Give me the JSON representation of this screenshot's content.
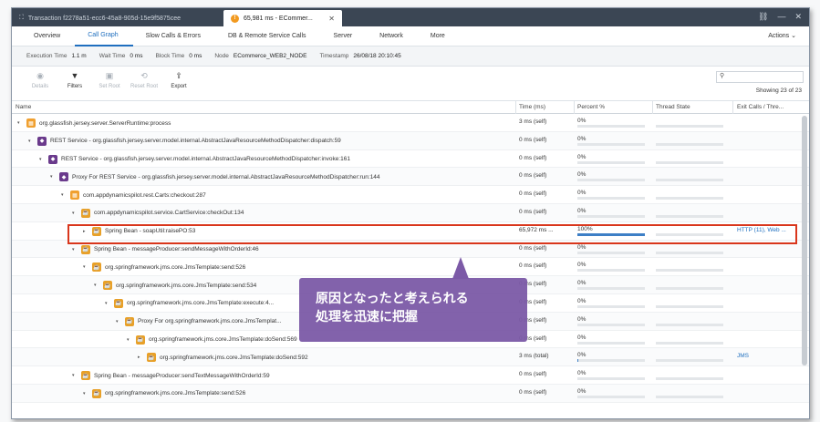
{
  "tabs": [
    {
      "label": "Transaction f2278a51-ecc6-45a8-905d-15e9f5875cee",
      "active": false
    },
    {
      "label": "65,981 ms - ECommer...",
      "active": true
    }
  ],
  "nav": [
    "Overview",
    "Call Graph",
    "Slow Calls & Errors",
    "DB & Remote Service Calls",
    "Server",
    "Network",
    "More"
  ],
  "actions_label": "Actions",
  "info": {
    "execution_time_label": "Execution Time",
    "execution_time": "1.1 m",
    "wait_time_label": "Wait Time",
    "wait_time": "0 ms",
    "block_time_label": "Block Time",
    "block_time": "0 ms",
    "node_label": "Node",
    "node": "ECommerce_WEB2_NODE",
    "timestamp_label": "Timestamp",
    "timestamp": "26/08/18 20:10:45"
  },
  "toolbar": {
    "details": "Details",
    "filters": "Filters",
    "set_root": "Set Root",
    "reset_root": "Reset Root",
    "export": "Export",
    "showing": "Showing 23 of 23"
  },
  "columns": {
    "name": "Name",
    "time": "Time (ms)",
    "percent": "Percent %",
    "thread": "Thread State",
    "exit": "Exit Calls / Thre..."
  },
  "rows": [
    {
      "depth": 0,
      "icon": "pkg",
      "label": "org.glassfish.jersey.server.ServerRuntime:process",
      "time": "3 ms (self)",
      "pct": "0%",
      "fill": 0
    },
    {
      "depth": 1,
      "icon": "rest",
      "label": "REST Service - org.glassfish.jersey.server.model.internal.AbstractJavaResourceMethodDispatcher:dispatch:59",
      "time": "0 ms (self)",
      "pct": "0%",
      "fill": 0
    },
    {
      "depth": 2,
      "icon": "rest",
      "label": "REST Service - org.glassfish.jersey.server.model.internal.AbstractJavaResourceMethodDispatcher:invoke:161",
      "time": "0 ms (self)",
      "pct": "0%",
      "fill": 0
    },
    {
      "depth": 3,
      "icon": "rest",
      "label": "Proxy For REST Service - org.glassfish.jersey.server.model.internal.AbstractJavaResourceMethodDispatcher:run:144",
      "time": "0 ms (self)",
      "pct": "0%",
      "fill": 0
    },
    {
      "depth": 4,
      "icon": "pkg",
      "label": "com.appdynamicspilot.rest.Carts:checkout:287",
      "time": "0 ms (self)",
      "pct": "0%",
      "fill": 0
    },
    {
      "depth": 5,
      "icon": "java",
      "label": "com.appdynamicspilot.service.CartService:checkOut:134",
      "time": "0 ms (self)",
      "pct": "0%",
      "fill": 0
    },
    {
      "depth": 6,
      "icon": "java",
      "label": "Spring Bean - soapUtil:raisePO:53",
      "time": "65,972 ms ...",
      "pct": "100%",
      "fill": 1,
      "exit": "HTTP (11), Web ..."
    },
    {
      "depth": 5,
      "icon": "java",
      "label": "Spring Bean - messageProducer:sendMessageWithOrderId:46",
      "time": "0 ms (self)",
      "pct": "0%",
      "fill": 0
    },
    {
      "depth": 6,
      "icon": "java",
      "label": "org.springframework.jms.core.JmsTemplate:send:526",
      "time": "0 ms (self)",
      "pct": "0%",
      "fill": 0
    },
    {
      "depth": 7,
      "icon": "java",
      "label": "org.springframework.jms.core.JmsTemplate:send:534",
      "time": "0 ms (self)",
      "pct": "0%",
      "fill": 0
    },
    {
      "depth": 8,
      "icon": "java",
      "label": "org.springframework.jms.core.JmsTemplate:execute:4...",
      "time": "0 ms (self)",
      "pct": "0%",
      "fill": 0
    },
    {
      "depth": 9,
      "icon": "java",
      "label": "Proxy For org.springframework.jms.core.JmsTemplat...",
      "time": "0 ms (self)",
      "pct": "0%",
      "fill": 0
    },
    {
      "depth": 10,
      "icon": "java",
      "label": "org.springframework.jms.core.JmsTemplate:doSend:569",
      "time": "0 ms (self)",
      "pct": "0%",
      "fill": 0
    },
    {
      "depth": 11,
      "icon": "java",
      "label": "org.springframework.jms.core.JmsTemplate:doSend:592",
      "time": "3 ms (total)",
      "pct": "0%",
      "fill": 0.01,
      "exit": "JMS"
    },
    {
      "depth": 5,
      "icon": "java",
      "label": "Spring Bean - messageProducer:sendTextMessageWithOrderId:59",
      "time": "0 ms (self)",
      "pct": "0%",
      "fill": 0
    },
    {
      "depth": 6,
      "icon": "java",
      "label": "org.springframework.jms.core.JmsTemplate:send:526",
      "time": "0 ms (self)",
      "pct": "0%",
      "fill": 0
    }
  ],
  "callout": {
    "line1": "原因となったと考えられる",
    "line2": "処理を迅速に把握"
  }
}
